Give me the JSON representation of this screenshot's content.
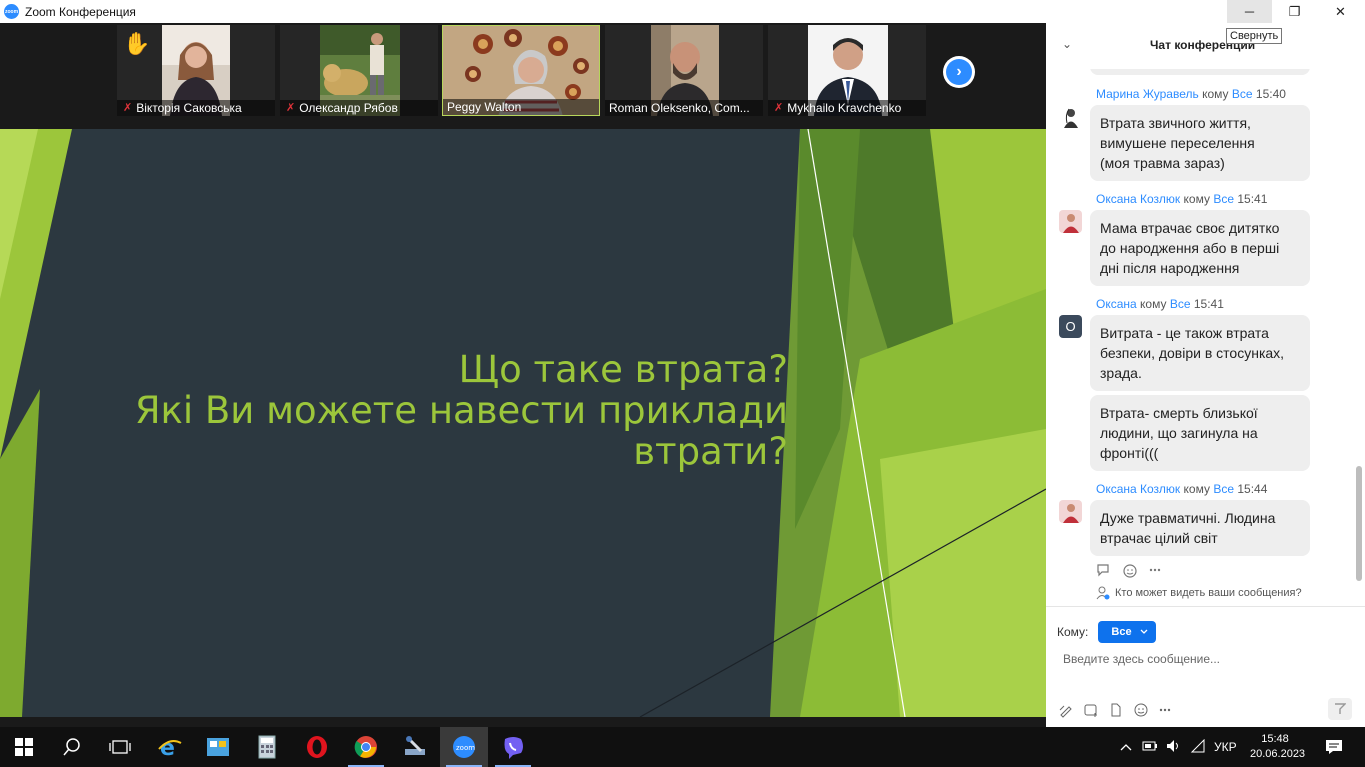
{
  "window": {
    "title": "Zoom Конференция",
    "logo_text": "zoom",
    "tooltip": "Свернуть",
    "controls": {
      "minimize": "─",
      "maximize": "❐",
      "close": "✕"
    }
  },
  "participants": [
    {
      "name": "Вікторія Саковська",
      "muted": true,
      "raised_hand": true
    },
    {
      "name": "Олександр Рябов",
      "muted": true
    },
    {
      "name": "Peggy Walton",
      "muted": false,
      "active_speaker": true
    },
    {
      "name": "Roman Oleksenko, Com...",
      "muted": false
    },
    {
      "name": "Mykhailo Kravchenko",
      "muted": true
    }
  ],
  "icons": {
    "mic_off": "✗",
    "raised_hand": "✋",
    "next": "›"
  },
  "slide": {
    "lines": [
      "Що таке втрата?",
      "Які Ви можете навести приклади",
      "втрати?"
    ],
    "colors": {
      "background": "#2c3840",
      "text": "#9cc63b",
      "green_light": "#9cc63b",
      "green_dark": "#5a8a2c"
    }
  },
  "chat": {
    "title": "Чат конференции",
    "collapse_icon": "⌄",
    "messages": [
      {
        "sender": "Марина Журавель",
        "to_word": "кому",
        "to": "Все",
        "time": "15:40",
        "avatar": "photo-icon",
        "text_lines": [
          "Втрата звичного життя,",
          "вимушене переселення",
          "(моя травма зараз)"
        ]
      },
      {
        "sender": "Оксана Козлюк",
        "to_word": "кому",
        "to": "Все",
        "time": "15:41",
        "avatar": "photo-icon",
        "text_lines": [
          "Мама втрачає своє дитятко",
          "до народження або в перші",
          "дні після народження"
        ]
      },
      {
        "sender": "Оксана",
        "to_word": "кому",
        "to": "Все",
        "time": "15:41",
        "avatar_letter": "O",
        "text_lines": [
          "Витрата - це також втрата",
          "безпеки, довіри в стосунках,",
          "зрада."
        ]
      },
      {
        "text_lines": [
          "Втрата- смерть близької",
          "людини, що загинула на",
          "фронті((("
        ]
      },
      {
        "sender": "Оксана Козлюк",
        "to_word": "кому",
        "to": "Все",
        "time": "15:44",
        "avatar": "photo-icon",
        "text_lines": [
          "Дуже травматичні. Людина",
          "втрачає цілий світ"
        ]
      }
    ],
    "who_can_see": "Кто может видеть ваши сообщения?",
    "to_label": "Кому:",
    "to_value": "Все",
    "input_placeholder": "Введите здесь сообщение...",
    "accent": "#0e72ed"
  },
  "taskbar": {
    "apps": [
      "start-icon",
      "search-icon",
      "task-view-icon",
      "internet-explorer-icon",
      "file-manager-icon",
      "calculator-icon",
      "opera-icon",
      "chrome-icon",
      "tools-icon",
      "zoom-icon",
      "viber-icon"
    ],
    "lang": "УКР",
    "time": "15:48",
    "date": "20.06.2023"
  }
}
